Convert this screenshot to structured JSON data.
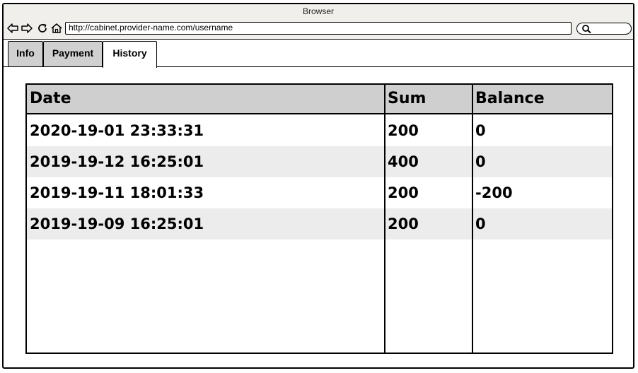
{
  "window": {
    "title": "Browser"
  },
  "toolbar": {
    "back_icon": "back-arrow-icon",
    "forward_icon": "forward-arrow-icon",
    "reload_icon": "reload-icon",
    "home_icon": "home-icon",
    "address": "http://cabinet.provider-name.com/username",
    "search_icon": "search-icon"
  },
  "tabs": [
    {
      "label": "Info",
      "active": false
    },
    {
      "label": "Payment",
      "active": false
    },
    {
      "label": "History",
      "active": true
    }
  ],
  "history_table": {
    "columns": [
      "Date",
      "Sum",
      "Balance"
    ],
    "rows": [
      {
        "date": "2020-19-01 23:33:31",
        "sum": "200",
        "balance": "0"
      },
      {
        "date": "2019-19-12 16:25:01",
        "sum": "400",
        "balance": "0"
      },
      {
        "date": "2019-19-11 18:01:33",
        "sum": "200",
        "balance": "-200"
      },
      {
        "date": "2019-19-09 16:25:01",
        "sum": "200",
        "balance": "0"
      }
    ]
  },
  "colors": {
    "titlebar_bg": "#f0efeb",
    "tab_inactive_bg": "#d0d0d0",
    "header_bg": "#cfcfcf",
    "alt_row_bg": "#ececec"
  }
}
